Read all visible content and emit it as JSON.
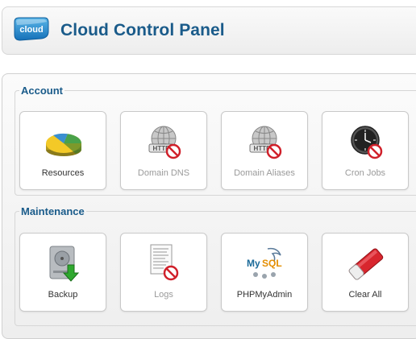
{
  "header": {
    "logo_text": "cloud",
    "title": "Cloud Control Panel"
  },
  "sections": [
    {
      "title": "Account",
      "items": [
        {
          "label": "Resources",
          "icon": "pie-chart-icon",
          "disabled": false
        },
        {
          "label": "Domain DNS",
          "icon": "globe-http-icon",
          "disabled": true
        },
        {
          "label": "Domain Aliases",
          "icon": "globe-http-icon",
          "disabled": true
        },
        {
          "label": "Cron Jobs",
          "icon": "clock-icon",
          "disabled": true
        }
      ]
    },
    {
      "title": "Maintenance",
      "items": [
        {
          "label": "Backup",
          "icon": "hard-drive-download-icon",
          "disabled": false
        },
        {
          "label": "Logs",
          "icon": "log-document-icon",
          "disabled": true
        },
        {
          "label": "PHPMyAdmin",
          "icon": "mysql-icon",
          "disabled": false
        },
        {
          "label": "Clear All",
          "icon": "eraser-icon",
          "disabled": false
        }
      ]
    }
  ],
  "colors": {
    "title": "#1a5b8a",
    "disabled_text": "#9a9a9a",
    "no_symbol": "#d0202a"
  }
}
